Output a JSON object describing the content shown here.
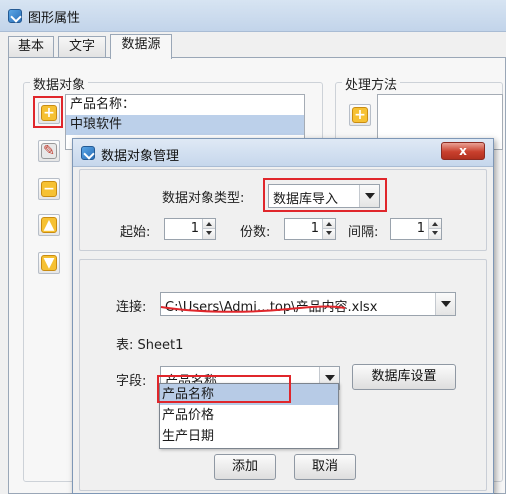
{
  "window": {
    "title": "图形属性"
  },
  "tabs": [
    {
      "label": "基本"
    },
    {
      "label": "文字"
    },
    {
      "label": "数据源"
    }
  ],
  "data_objects": {
    "group_label": "数据对象",
    "items": [
      "产品名称：",
      "中琅软件"
    ]
  },
  "processing": {
    "group_label": "处理方法"
  },
  "dialog": {
    "title": "数据对象管理",
    "close_label": "x",
    "type_label": "数据对象类型:",
    "type_value": "数据库导入",
    "start_label": "起始:",
    "start_value": "1",
    "count_label": "份数:",
    "count_value": "1",
    "interval_label": "间隔:",
    "interval_value": "1",
    "connection_label": "连接:",
    "connection_value": "C:\\Users\\Admi…top\\产品内容.xlsx",
    "table_label": "表: Sheet1",
    "field_label": "字段:",
    "field_value": "产品名称",
    "db_settings_label": "数据库设置",
    "field_options": [
      "产品名称",
      "产品价格",
      "生产日期"
    ],
    "add_label": "添加",
    "cancel_label": "取消"
  },
  "colors": {
    "highlight_box": "#e0262b",
    "selection": "#bcd0ea",
    "title_bar": "#c6d7ec"
  }
}
